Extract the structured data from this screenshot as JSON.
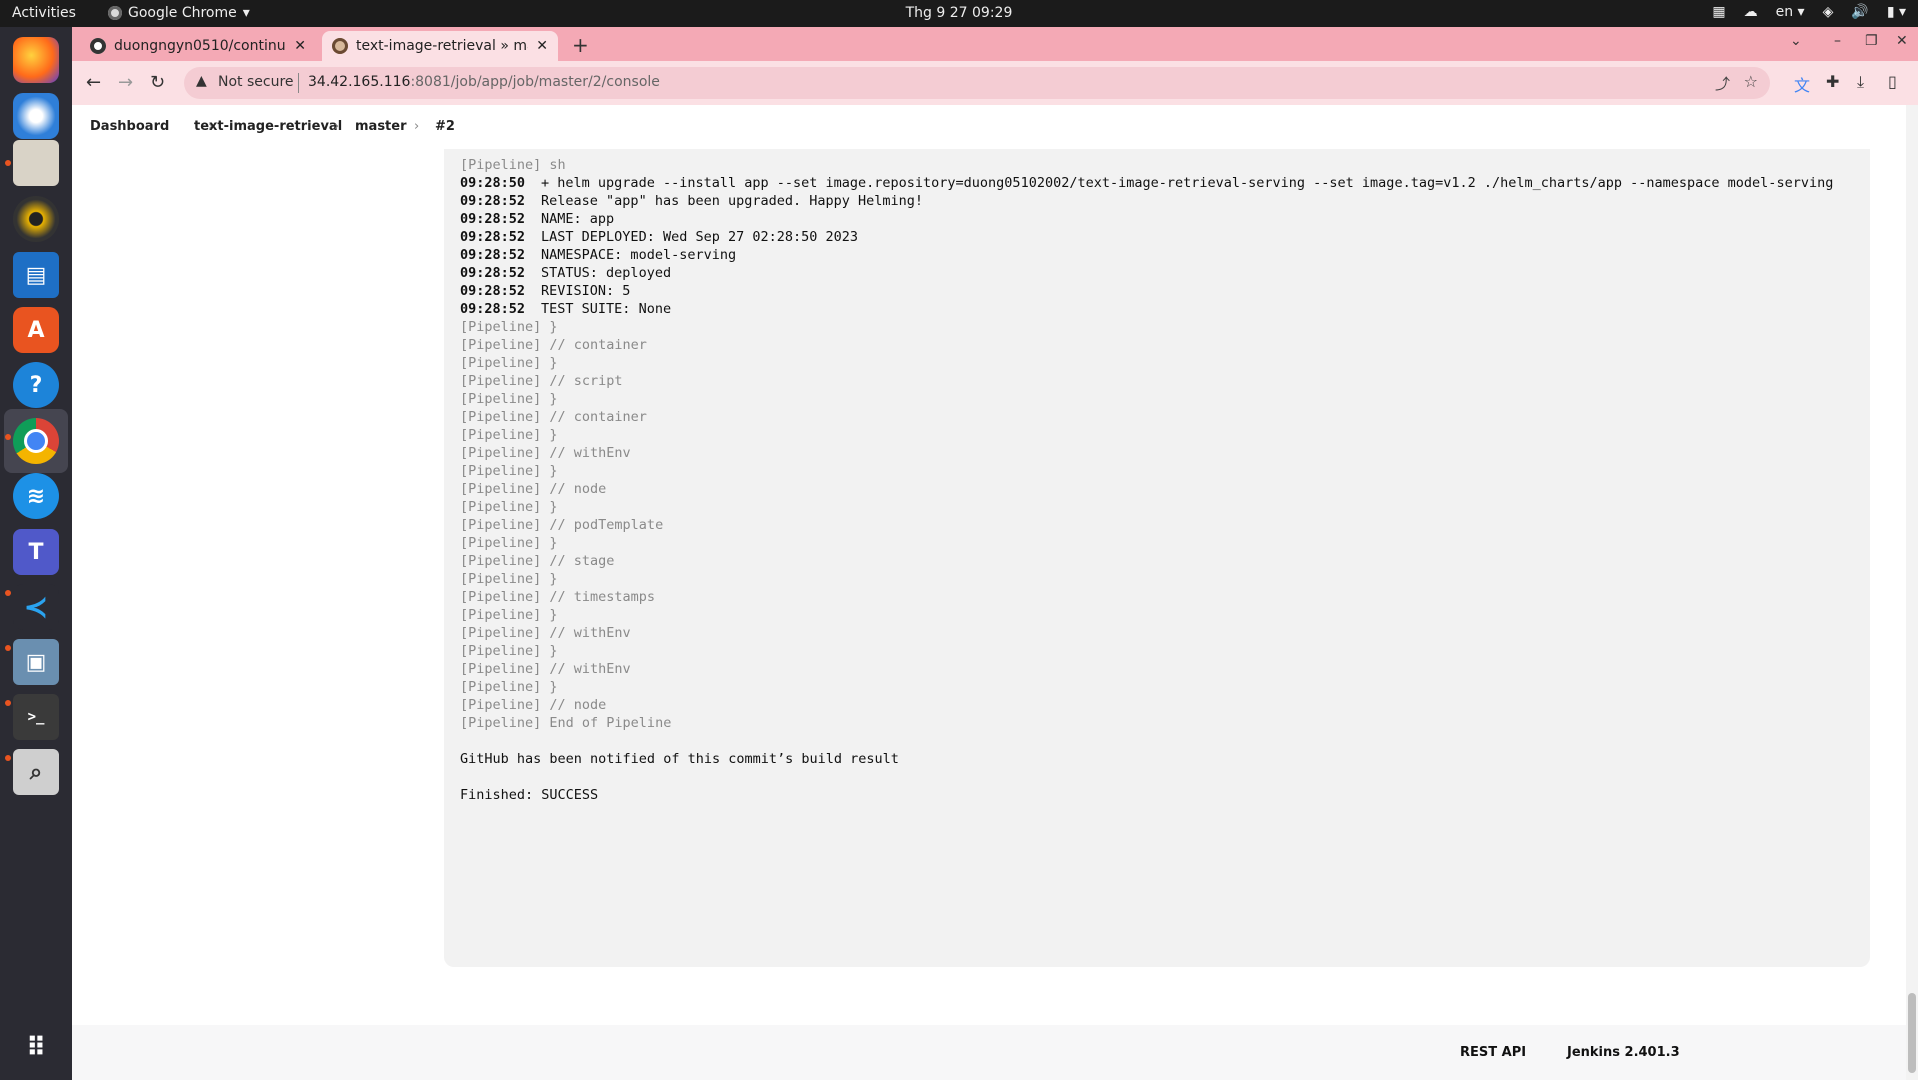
{
  "topbar": {
    "activities": "Activities",
    "app_name": "Google Chrome",
    "clock": "Thg 9 27  09:29",
    "lang": "en"
  },
  "browser": {
    "tabs": [
      {
        "title": "duongngyn0510/continu",
        "active": false
      },
      {
        "title": "text-image-retrieval » ma",
        "active": true
      }
    ],
    "not_secure": "Not secure",
    "url_host": "34.42.165.116",
    "url_path": ":8081/job/app/job/master/2/console"
  },
  "breadcrumb": [
    "Dashboard",
    "text-image-retrieval",
    "master",
    "#2"
  ],
  "console": {
    "lines": [
      {
        "ts": "",
        "text": "[Pipeline] sh",
        "kind": "pipe"
      },
      {
        "ts": "09:28:50",
        "text": "+ helm upgrade --install app --set image.repository=duong05102002/text-image-retrieval-serving --set image.tag=v1.2 ./helm_charts/app --namespace model-serving",
        "kind": "out"
      },
      {
        "ts": "09:28:52",
        "text": "Release \"app\" has been upgraded. Happy Helming!",
        "kind": "out"
      },
      {
        "ts": "09:28:52",
        "text": "NAME: app",
        "kind": "out"
      },
      {
        "ts": "09:28:52",
        "text": "LAST DEPLOYED: Wed Sep 27 02:28:50 2023",
        "kind": "out"
      },
      {
        "ts": "09:28:52",
        "text": "NAMESPACE: model-serving",
        "kind": "out"
      },
      {
        "ts": "09:28:52",
        "text": "STATUS: deployed",
        "kind": "out"
      },
      {
        "ts": "09:28:52",
        "text": "REVISION: 5",
        "kind": "out"
      },
      {
        "ts": "09:28:52",
        "text": "TEST SUITE: None",
        "kind": "out"
      },
      {
        "ts": "",
        "text": "[Pipeline] }",
        "kind": "pipe"
      },
      {
        "ts": "",
        "text": "[Pipeline] // container",
        "kind": "pipe"
      },
      {
        "ts": "",
        "text": "[Pipeline] }",
        "kind": "pipe"
      },
      {
        "ts": "",
        "text": "[Pipeline] // script",
        "kind": "pipe"
      },
      {
        "ts": "",
        "text": "[Pipeline] }",
        "kind": "pipe"
      },
      {
        "ts": "",
        "text": "[Pipeline] // container",
        "kind": "pipe"
      },
      {
        "ts": "",
        "text": "[Pipeline] }",
        "kind": "pipe"
      },
      {
        "ts": "",
        "text": "[Pipeline] // withEnv",
        "kind": "pipe"
      },
      {
        "ts": "",
        "text": "[Pipeline] }",
        "kind": "pipe"
      },
      {
        "ts": "",
        "text": "[Pipeline] // node",
        "kind": "pipe"
      },
      {
        "ts": "",
        "text": "[Pipeline] }",
        "kind": "pipe"
      },
      {
        "ts": "",
        "text": "[Pipeline] // podTemplate",
        "kind": "pipe"
      },
      {
        "ts": "",
        "text": "[Pipeline] }",
        "kind": "pipe"
      },
      {
        "ts": "",
        "text": "[Pipeline] // stage",
        "kind": "pipe"
      },
      {
        "ts": "",
        "text": "[Pipeline] }",
        "kind": "pipe"
      },
      {
        "ts": "",
        "text": "[Pipeline] // timestamps",
        "kind": "pipe"
      },
      {
        "ts": "",
        "text": "[Pipeline] }",
        "kind": "pipe"
      },
      {
        "ts": "",
        "text": "[Pipeline] // withEnv",
        "kind": "pipe"
      },
      {
        "ts": "",
        "text": "[Pipeline] }",
        "kind": "pipe"
      },
      {
        "ts": "",
        "text": "[Pipeline] // withEnv",
        "kind": "pipe"
      },
      {
        "ts": "",
        "text": "[Pipeline] }",
        "kind": "pipe"
      },
      {
        "ts": "",
        "text": "[Pipeline] // node",
        "kind": "pipe"
      },
      {
        "ts": "",
        "text": "[Pipeline] End of Pipeline",
        "kind": "pipe"
      },
      {
        "ts": "",
        "text": "",
        "kind": "blank"
      },
      {
        "ts": "",
        "text": "GitHub has been notified of this commit’s build result",
        "kind": "out"
      },
      {
        "ts": "",
        "text": "",
        "kind": "blank"
      },
      {
        "ts": "",
        "text": "Finished: SUCCESS",
        "kind": "out"
      }
    ]
  },
  "footer": {
    "rest_api": "REST API",
    "version": "Jenkins 2.401.3"
  },
  "dock": {
    "apps": [
      "firefox-icon",
      "thunderbird-icon",
      "files-icon",
      "rhythmbox-icon",
      "writer-icon",
      "app-center-icon",
      "help-icon",
      "chrome-icon",
      "docker-icon",
      "teams-icon",
      "vscode-icon",
      "image-viewer-icon",
      "terminal-icon",
      "search-tool-icon",
      "show-apps-icon"
    ]
  }
}
